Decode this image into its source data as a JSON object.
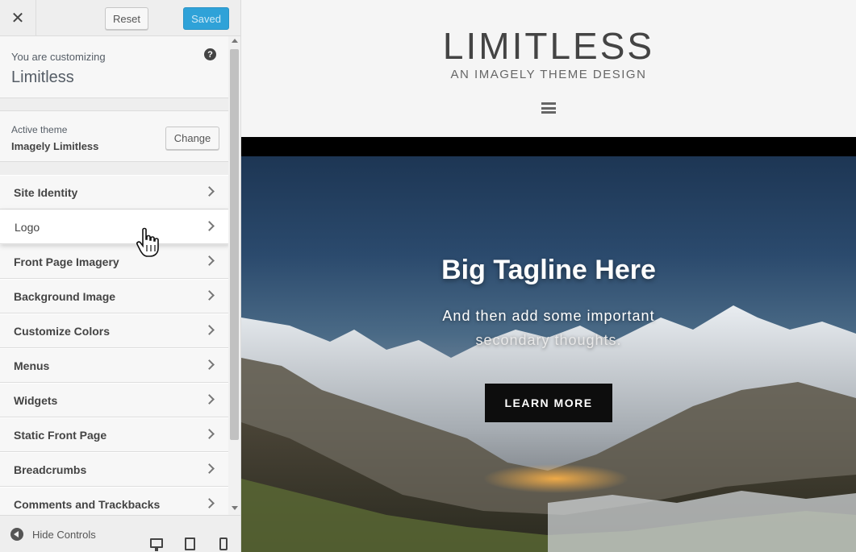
{
  "topbar": {
    "close_label": "✕",
    "reset_label": "Reset",
    "saved_label": "Saved"
  },
  "info": {
    "label": "You are customizing",
    "title": "Limitless",
    "help_glyph": "?"
  },
  "theme": {
    "label": "Active theme",
    "name": "Imagely Limitless",
    "change_label": "Change"
  },
  "panels": [
    {
      "label": "Site Identity"
    },
    {
      "label": "Logo"
    },
    {
      "label": "Front Page Imagery"
    },
    {
      "label": "Background Image"
    },
    {
      "label": "Customize Colors"
    },
    {
      "label": "Menus"
    },
    {
      "label": "Widgets"
    },
    {
      "label": "Static Front Page"
    },
    {
      "label": "Breadcrumbs"
    },
    {
      "label": "Comments and Trackbacks"
    }
  ],
  "active_panel_index": 1,
  "footer": {
    "hide_label": "Hide Controls",
    "devices": [
      "desktop-icon",
      "tablet-icon",
      "mobile-icon"
    ]
  },
  "preview": {
    "site_title": "LIMITLESS",
    "site_tagline": "AN IMAGELY THEME DESIGN",
    "hero_title": "Big Tagline Here",
    "hero_sub_line1": "And then add some important",
    "hero_sub_line2": "secondary thoughts.",
    "cta_label": "LEARN MORE"
  },
  "colors": {
    "saved_button": "#2fa2d8",
    "sidebar_bg": "#eeeeee",
    "panel_bg": "#f7f7f7",
    "cta_bg": "#0d0d0d"
  }
}
